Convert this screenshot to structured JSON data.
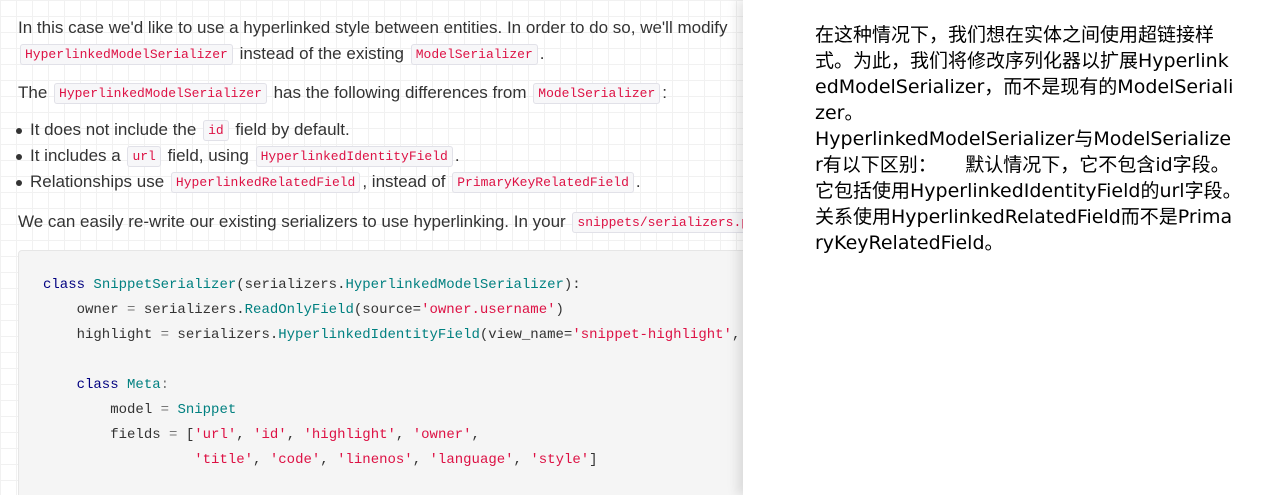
{
  "doc": {
    "para1_line1": "In this case we'd like to use a hyperlinked style between entities. In order to do so, we'll modify",
    "para1_line2_code1": "HyperlinkedModelSerializer",
    "para1_line2_text": " instead of the existing ",
    "para1_line2_code2": "ModelSerializer",
    "para1_line2_end": ".",
    "para2_text1": "The ",
    "para2_code1": "HyperlinkedModelSerializer",
    "para2_text2": " has the following differences from ",
    "para2_code2": "ModelSerializer",
    "para2_end": ":",
    "bullets": [
      {
        "t1": "It does not include the ",
        "c1": "id",
        "t2": " field by default.",
        "c2": "",
        "t3": ""
      },
      {
        "t1": "It includes a ",
        "c1": "url",
        "t2": " field, using ",
        "c2": "HyperlinkedIdentityField",
        "t3": "."
      },
      {
        "t1": "Relationships use ",
        "c1": "HyperlinkedRelatedField",
        "t2": ", instead of ",
        "c2": "PrimaryKeyRelatedField",
        "t3": "."
      }
    ],
    "para3_text": "We can easily re-write our existing serializers to use hyperlinking. In your ",
    "para3_code": "snippets/serializers.py"
  },
  "code": {
    "l1_kw": "class",
    "l1_name": "SnippetSerializer",
    "l1_open": "(serializers.",
    "l1_base": "HyperlinkedModelSerializer",
    "l1_close": "):",
    "l2_a": "    owner ",
    "l2_eq": "=",
    "l2_b": " serializers.",
    "l2_cls": "ReadOnlyField",
    "l2_c": "(source=",
    "l2_str": "'owner.username'",
    "l2_d": ")",
    "l3_a": "    highlight ",
    "l3_eq": "=",
    "l3_b": " serializers.",
    "l3_cls": "HyperlinkedIdentityField",
    "l3_c": "(view_name=",
    "l3_str": "'snippet-highlight'",
    "l3_d": ", format=",
    "l5_kw": "    class",
    "l5_name": "Meta",
    "l5_c": ":",
    "l6_a": "        model ",
    "l6_eq": "=",
    "l6_val": "Snippet",
    "l7_a": "        fields ",
    "l7_eq": "=",
    "l7_open": " [",
    "l7_items": [
      "'url'",
      "'id'",
      "'highlight'",
      "'owner'"
    ],
    "l8_items": [
      "'title'",
      "'code'",
      "'linenos'",
      "'language'",
      "'style'"
    ],
    "l8_close": "]"
  },
  "translation": {
    "text": "在这种情况下，我们想在实体之间使用超链接样式。为此，我们将修改序列化器以扩展HyperlinkedModelSerializer，而不是现有的ModelSerializer。\nHyperlinkedModelSerializer与ModelSerializer有以下区别：　　默认情况下，它不包含id字段。　　它包括使用HyperlinkedIdentityField的url字段。　　关系使用HyperlinkedRelatedField而不是PrimaryKeyRelatedField。"
  }
}
